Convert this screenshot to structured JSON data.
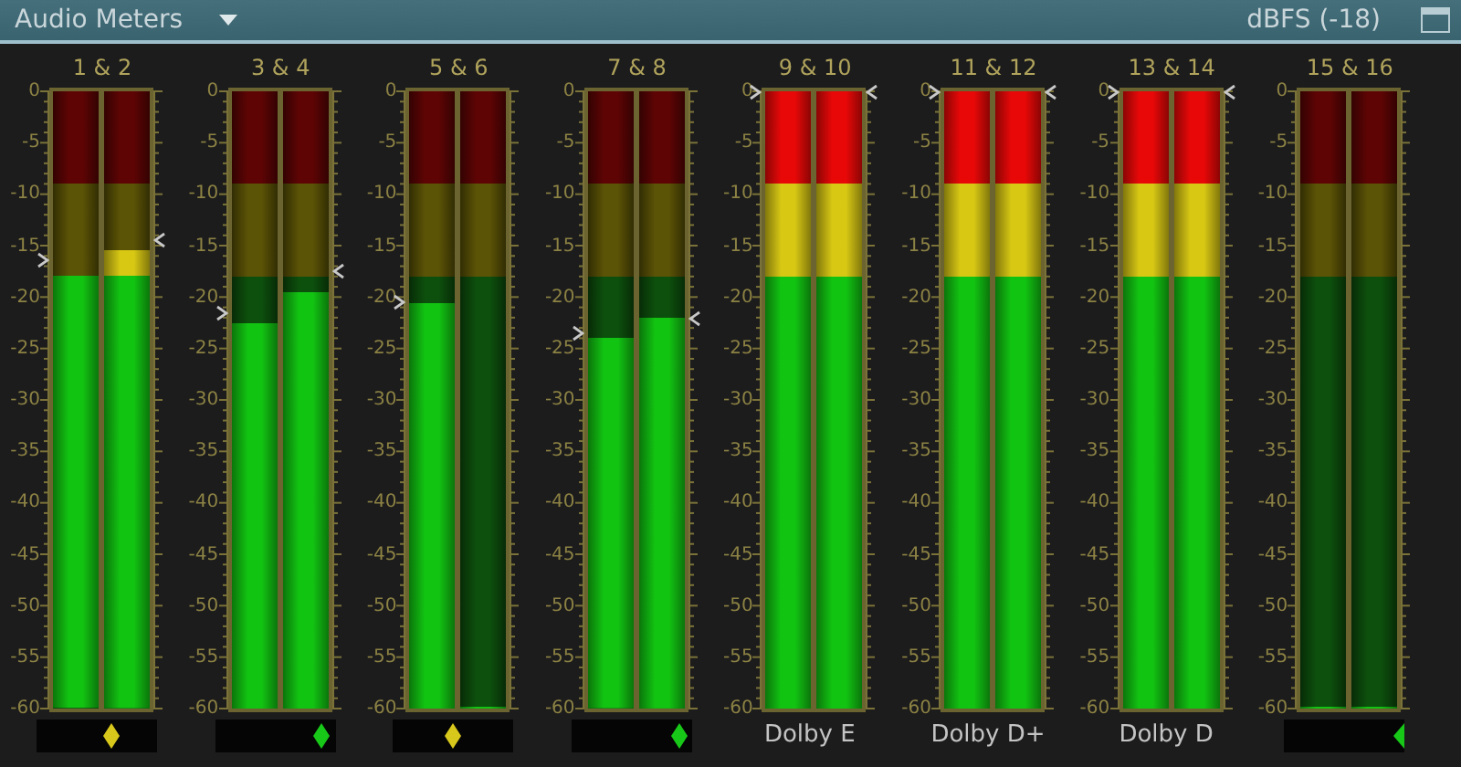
{
  "title_bar": {
    "title": "Audio Meters",
    "unit": "dBFS (-18)"
  },
  "meters": [
    {
      "label": "1 & 2",
      "scale": [
        "0",
        "-5",
        "-10",
        "-15",
        "-20",
        "-25",
        "-30",
        "-35",
        "-40",
        "-45",
        "-50",
        "-55",
        "-60"
      ],
      "channels": [
        {
          "level": 0.7,
          "peak": {
            "level": 0.725
          }
        },
        {
          "level": 0.742,
          "peak": {
            "level": 0.758
          }
        }
      ],
      "footer": {
        "kind": "balance",
        "marker": {
          "kind": "diamond",
          "color": "#d8c81c",
          "level": 0.62
        }
      }
    },
    {
      "label": "3 & 4",
      "scale": [
        "0",
        "-5",
        "-10",
        "-15",
        "-20",
        "-25",
        "-30",
        "-35",
        "-40",
        "-45",
        "-50",
        "-55",
        "-60"
      ],
      "channels": [
        {
          "level": 0.625,
          "peak": {
            "level": 0.642
          }
        },
        {
          "level": 0.675,
          "peak": {
            "level": 0.708
          }
        }
      ],
      "footer": {
        "kind": "balance",
        "marker": {
          "kind": "diamond",
          "color": "#18c818",
          "level": 0.88
        }
      }
    },
    {
      "label": "5 & 6",
      "scale": [
        "0",
        "-5",
        "-10",
        "-15",
        "-20",
        "-25",
        "-30",
        "-35",
        "-40",
        "-45",
        "-50",
        "-55",
        "-60"
      ],
      "channels": [
        {
          "level": 0.658,
          "peak": {
            "level": 0.658
          }
        },
        {
          "level": 0
        }
      ],
      "footer": {
        "kind": "balance",
        "marker": {
          "kind": "diamond",
          "color": "#d8c81c",
          "level": 0.49
        }
      }
    },
    {
      "label": "7 & 8",
      "scale": [
        "0",
        "-5",
        "-10",
        "-15",
        "-20",
        "-25",
        "-30",
        "-35",
        "-40",
        "-45",
        "-50",
        "-55",
        "-60"
      ],
      "channels": [
        {
          "level": 0.6,
          "peak": {
            "level": 0.608
          }
        },
        {
          "level": 0.633,
          "peak": {
            "level": 0.633
          }
        }
      ],
      "footer": {
        "kind": "balance",
        "marker": {
          "kind": "diamond",
          "color": "#18c818",
          "level": 0.9
        }
      }
    },
    {
      "label": "9 & 10",
      "scale": [
        "0",
        "-5",
        "-10",
        "-15",
        "-20",
        "-25",
        "-30",
        "-35",
        "-40",
        "-45",
        "-50",
        "-55",
        "-60"
      ],
      "channels": [
        {
          "level": 1,
          "peak": {
            "level": 1
          }
        },
        {
          "level": 1,
          "peak": {
            "level": 1
          }
        }
      ],
      "footer": {
        "kind": "format",
        "text": "Dolby E"
      }
    },
    {
      "label": "11 & 12",
      "scale": [
        "0",
        "-5",
        "-10",
        "-15",
        "-20",
        "-25",
        "-30",
        "-35",
        "-40",
        "-45",
        "-50",
        "-55",
        "-60"
      ],
      "channels": [
        {
          "level": 1,
          "peak": {
            "level": 1
          }
        },
        {
          "level": 1,
          "peak": {
            "level": 1
          }
        }
      ],
      "footer": {
        "kind": "format",
        "text": "Dolby D+"
      }
    },
    {
      "label": "13 & 14",
      "scale": [
        "0",
        "-5",
        "-10",
        "-15",
        "-20",
        "-25",
        "-30",
        "-35",
        "-40",
        "-45",
        "-50",
        "-55",
        "-60"
      ],
      "channels": [
        {
          "level": 1,
          "peak": {
            "level": 1
          }
        },
        {
          "level": 1,
          "peak": {
            "level": 1
          }
        }
      ],
      "footer": {
        "kind": "format",
        "text": "Dolby D"
      }
    },
    {
      "label": "15 & 16",
      "scale": [
        "0",
        "-5",
        "-10",
        "-15",
        "-20",
        "-25",
        "-30",
        "-35",
        "-40",
        "-45",
        "-50",
        "-55",
        "-60"
      ],
      "channels": [
        {
          "level": 0
        },
        {
          "level": 0
        }
      ],
      "footer": {
        "kind": "balance",
        "marker": {
          "kind": "arrow",
          "color": "#18c818",
          "level": 1
        }
      }
    }
  ]
}
